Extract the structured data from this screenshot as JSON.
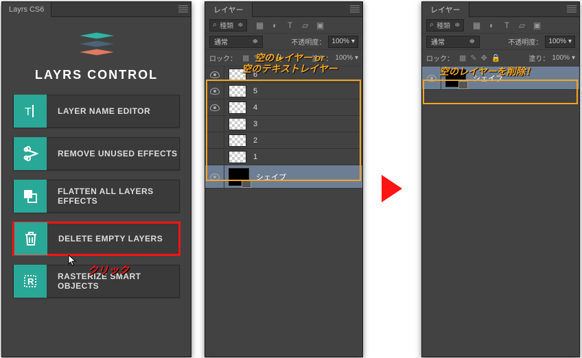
{
  "layrs": {
    "tabTitle": "Layrs CS6",
    "logoTitle": "LAYRS CONTROL",
    "buttons": [
      {
        "label": "LAYER NAME EDITOR",
        "name": "layer-name-editor-button"
      },
      {
        "label": "REMOVE UNUSED EFFECTS",
        "name": "remove-unused-effects-button"
      },
      {
        "label": "FLATTEN ALL LAYERS EFFECTS",
        "name": "flatten-all-layers-effects-button"
      },
      {
        "label": "DELETE EMPTY LAYERS",
        "name": "delete-empty-layers-button"
      },
      {
        "label": "RASTERIZE SMART OBJECTS",
        "name": "rasterize-smart-objects-button"
      }
    ],
    "clickLabel": "クリック"
  },
  "layersPanel": {
    "tabTitle": "レイヤー",
    "kindLabel": "種類",
    "blendMode": "通常",
    "opacityLabel": "不透明度：",
    "opacityValue": "100%",
    "lockLabel": "ロック：",
    "fillLabel": "塗り：",
    "fillValue": "100%"
  },
  "beforeLayers": [
    {
      "name": "6",
      "visible": true
    },
    {
      "name": "5",
      "visible": true
    },
    {
      "name": "4",
      "visible": true
    },
    {
      "name": "3",
      "visible": false
    },
    {
      "name": "2",
      "visible": false
    },
    {
      "name": "1",
      "visible": false
    }
  ],
  "shapeLayerName": "シェイプ",
  "callouts": {
    "empty1": "空のレイヤー or",
    "empty2": "空のテキストレイヤー",
    "deleted": "空のレイヤーを削除！"
  }
}
